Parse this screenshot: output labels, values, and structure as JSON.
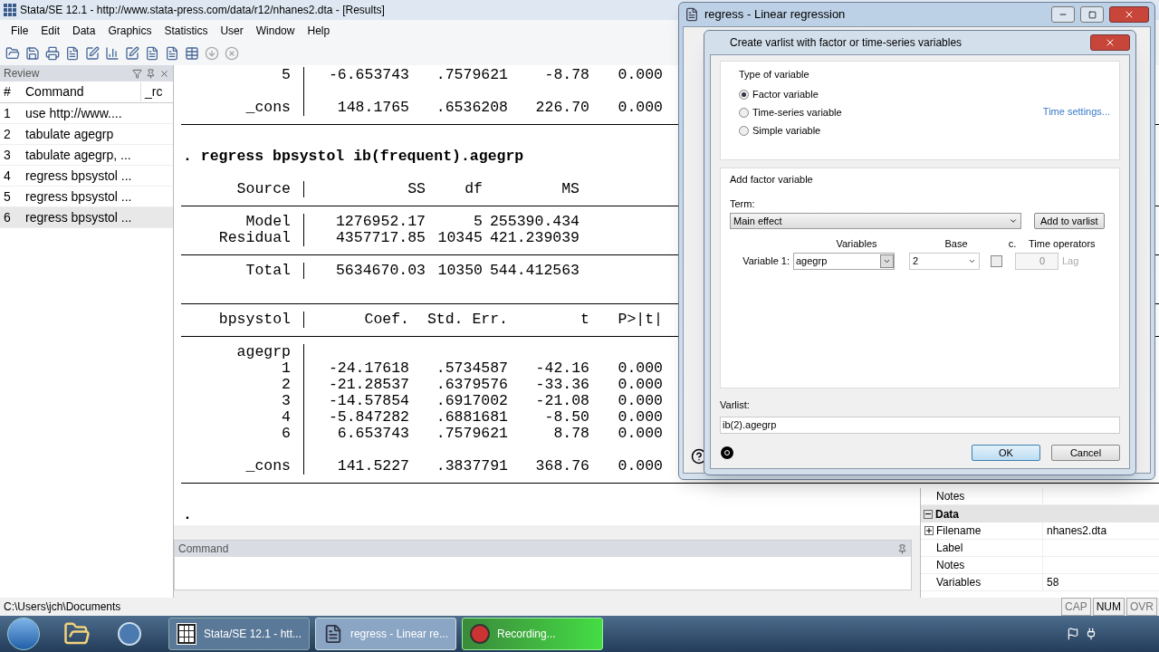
{
  "window": {
    "title": "Stata/SE 12.1 - http://www.stata-press.com/data/r12/nhanes2.dta - [Results]"
  },
  "menu": [
    "File",
    "Edit",
    "Data",
    "Graphics",
    "Statistics",
    "User",
    "Window",
    "Help"
  ],
  "review": {
    "title": "Review",
    "columns": [
      "#",
      "Command",
      "_rc"
    ],
    "rows": [
      {
        "num": "1",
        "command": "use http://www....",
        "selected": false
      },
      {
        "num": "2",
        "command": "tabulate agegrp",
        "selected": false
      },
      {
        "num": "3",
        "command": "tabulate agegrp, ...",
        "selected": false
      },
      {
        "num": "4",
        "command": "regress bpsystol ...",
        "selected": false
      },
      {
        "num": "5",
        "command": "regress bpsystol ...",
        "selected": false
      },
      {
        "num": "6",
        "command": "regress bpsystol ...",
        "selected": true
      }
    ]
  },
  "results": {
    "lines": [
      {
        "kind": "coef",
        "label": "5",
        "cells": [
          "-6.653743",
          ".7579621",
          "-8.78",
          "0.000"
        ]
      },
      {
        "kind": "coef"
      },
      {
        "kind": "coef",
        "label": "_cons",
        "cells": [
          "148.1765",
          ".6536208",
          "226.70",
          "0.000"
        ]
      },
      {
        "kind": "rule"
      },
      {
        "kind": "blank"
      },
      {
        "kind": "command",
        "text": ". regress bpsystol ib(frequent).agegrp"
      },
      {
        "kind": "blank"
      },
      {
        "kind": "anova",
        "label": "Source",
        "cells": [
          "SS",
          "df",
          "MS"
        ]
      },
      {
        "kind": "rule"
      },
      {
        "kind": "anova",
        "label": "Model",
        "cells": [
          "1276952.17",
          "5",
          "255390.434"
        ]
      },
      {
        "kind": "anova",
        "label": "Residual",
        "cells": [
          "4357717.85",
          "10345",
          "421.239039"
        ]
      },
      {
        "kind": "rule"
      },
      {
        "kind": "anova",
        "label": "Total",
        "cells": [
          "5634670.03",
          "10350",
          "544.412563"
        ]
      },
      {
        "kind": "blank"
      },
      {
        "kind": "rule"
      },
      {
        "kind": "coef",
        "label": "bpsystol",
        "cells": [
          "Coef.",
          "Std. Err.",
          "t",
          "P>|t|"
        ]
      },
      {
        "kind": "rule"
      },
      {
        "kind": "coef",
        "label": "agegrp"
      },
      {
        "kind": "coef",
        "label": "1",
        "cells": [
          "-24.17618",
          ".5734587",
          "-42.16",
          "0.000"
        ]
      },
      {
        "kind": "coef",
        "label": "2",
        "cells": [
          "-21.28537",
          ".6379576",
          "-33.36",
          "0.000"
        ]
      },
      {
        "kind": "coef",
        "label": "3",
        "cells": [
          "-14.57854",
          ".6917002",
          "-21.08",
          "0.000"
        ]
      },
      {
        "kind": "coef",
        "label": "4",
        "cells": [
          "-5.847282",
          ".6881681",
          "-8.50",
          "0.000"
        ]
      },
      {
        "kind": "coef",
        "label": "6",
        "cells": [
          "6.653743",
          ".7579621",
          "8.78",
          "0.000"
        ]
      },
      {
        "kind": "coef"
      },
      {
        "kind": "coef",
        "label": "_cons",
        "cells": [
          "141.5227",
          ".3837791",
          "368.76",
          "0.000"
        ]
      },
      {
        "kind": "rule"
      },
      {
        "kind": "blank"
      },
      {
        "kind": "prompt",
        "text": "."
      }
    ]
  },
  "command_panel": {
    "title": "Command"
  },
  "properties": {
    "rows": [
      {
        "kind": "row",
        "name": "Notes"
      },
      {
        "kind": "group",
        "name": "Data",
        "expanded": true
      },
      {
        "kind": "row",
        "name": "Filename",
        "value": "nhanes2.dta",
        "expandable": true
      },
      {
        "kind": "row",
        "name": "Label"
      },
      {
        "kind": "row",
        "name": "Notes"
      },
      {
        "kind": "row",
        "name": "Variables",
        "value": "58"
      }
    ]
  },
  "status_bar": {
    "path": "C:\\Users\\jch\\Documents",
    "indicators": [
      {
        "label": "CAP",
        "on": false
      },
      {
        "label": "NUM",
        "on": true
      },
      {
        "label": "OVR",
        "on": false
      }
    ]
  },
  "taskbar": {
    "items": [
      {
        "kind": "stata",
        "label": "Stata/SE 12.1 - htt...",
        "selected": false
      },
      {
        "kind": "dialog",
        "label": "regress - Linear re...",
        "selected": true
      },
      {
        "kind": "recording",
        "label": "Recording...",
        "selected": false
      }
    ]
  },
  "dialog": {
    "title": "regress - Linear regression"
  },
  "varlist_dialog": {
    "title": "Create varlist with factor or time-series variables",
    "type_group": "Type of variable",
    "types": [
      {
        "label": "Factor variable",
        "selected": true
      },
      {
        "label": "Time-series variable",
        "selected": false
      },
      {
        "label": "Simple variable",
        "selected": false
      }
    ],
    "time_settings": "Time settings...",
    "add_group": "Add factor variable",
    "term_label": "Term:",
    "term": "Main effect",
    "add_button": "Add to varlist",
    "headers": [
      "Variables",
      "Base",
      "c.",
      "Time operators"
    ],
    "variable_label": "Variable 1:",
    "variable": "agegrp",
    "base": "2",
    "c_checked": false,
    "lag": "0",
    "lag_label": "Lag",
    "varlist_label": "Varlist:",
    "varlist": "ib(2).agegrp",
    "buttons": [
      {
        "label": "OK",
        "default": true
      },
      {
        "label": "Cancel",
        "default": false
      }
    ]
  }
}
